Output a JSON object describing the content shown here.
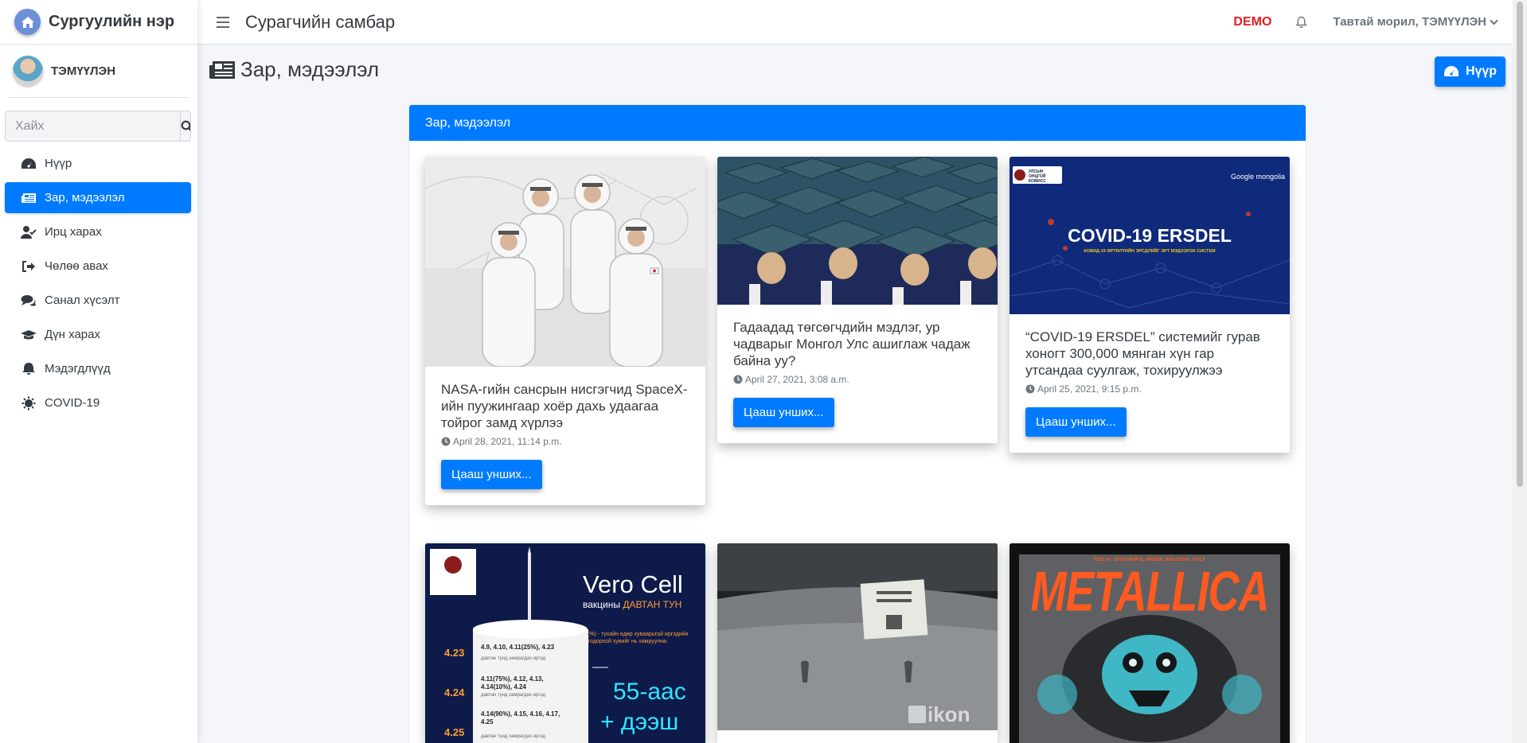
{
  "brand": {
    "name": "Сургуулийн нэр"
  },
  "user": {
    "name": "ТЭМҮҮЛЭН"
  },
  "search": {
    "placeholder": "Хайх"
  },
  "nav": [
    {
      "label": "Нүүр",
      "icon": "dashboard-icon",
      "active": false
    },
    {
      "label": "Зар, мэдээлэл",
      "icon": "newspaper-icon",
      "active": true
    },
    {
      "label": "Ирц харах",
      "icon": "user-check-icon",
      "active": false
    },
    {
      "label": "Чөлөө авах",
      "icon": "sign-out-icon",
      "active": false
    },
    {
      "label": "Санал хүсэлт",
      "icon": "comments-icon",
      "active": false
    },
    {
      "label": "Дүн харах",
      "icon": "graduation-cap-icon",
      "active": false
    },
    {
      "label": "Мэдэгдлүүд",
      "icon": "bell-icon",
      "active": false
    },
    {
      "label": "COVID-19",
      "icon": "virus-icon",
      "active": false
    }
  ],
  "topbar": {
    "title": "Сурагчийн самбар",
    "demo": "DEMO",
    "welcome": "Тавтай морил, ТЭМҮҮЛЭН"
  },
  "page": {
    "title": "Зар, мэдээлэл",
    "home_button": "Нүүр"
  },
  "card": {
    "header": "Зар, мэдээлэл"
  },
  "news": [
    {
      "title": "NASA-гийн сансрын нисгэгчид SpaceX-ийн пуужингаар хоёр дахь удаагаа тойрог замд хүрлээ",
      "date": "April 28, 2021, 11:14 p.m.",
      "button": "Цааш унших..."
    },
    {
      "title": "Гадаадад төгсөгчдийн мэдлэг, ур чадварыг Монгол Улс ашиглаж чадаж байна уу?",
      "date": "April 27, 2021, 3:08 a.m.",
      "button": "Цааш унших..."
    },
    {
      "title": "“COVID-19 ERSDEL” системийг гурав хоногт 300,000 мянган хүн гар утсандаа суулгаж, тохируулжээ",
      "date": "April 25, 2021, 9:15 p.m.",
      "button": "Цааш унших..."
    }
  ],
  "images": {
    "covid": {
      "logo_text": "УЛСЫН ОНЦГОЙ КОМИСС",
      "partners": "Google  mongolia",
      "title": "COVID-19 ERSDEL",
      "subtitle": "КОВИД-19 ӨРТӨЛТИЙН ЭРСДЛИЙГ ЭРТ МЭДЭЭЛЭХ СИСТЕМ"
    },
    "vero": {
      "title": "Vero Cell",
      "subtitle": "вакцины",
      "subtitle_accent": "ДАВТАН ТУН",
      "note": "(%) - тухайн өдөр хуваарьтай иргэдийн тодорхой хувийг нь хамруулна.",
      "rows": [
        {
          "day": "4.23",
          "text": "4.9, 4.10, 4.11(25%), 4.23"
        },
        {
          "day": "4.24",
          "text": "4.11(75%), 4.12, 4.13, 4.14(10%), 4.24"
        },
        {
          "day": "4.25",
          "text": "4.14(90%), 4.15, 4.16, 4.17, 4.25"
        }
      ],
      "row_caption": "давтан тунд хамрагдах иргэд",
      "big": "55-аас",
      "big2": "+ дээш"
    },
    "ikon": {
      "watermark": "ikon"
    },
    "metallica": {
      "band": "METALLICA",
      "top_line": "FEB 14 · 2018 UNIPOL ARENA, BOLOGNA, ITALY"
    }
  },
  "colors": {
    "accent": "#007bff",
    "demo": "#e31b23",
    "covid_bg": "#0f2a7a",
    "vero_bg": "#0d1a4a",
    "metallica_orange": "#ff5a1f"
  }
}
